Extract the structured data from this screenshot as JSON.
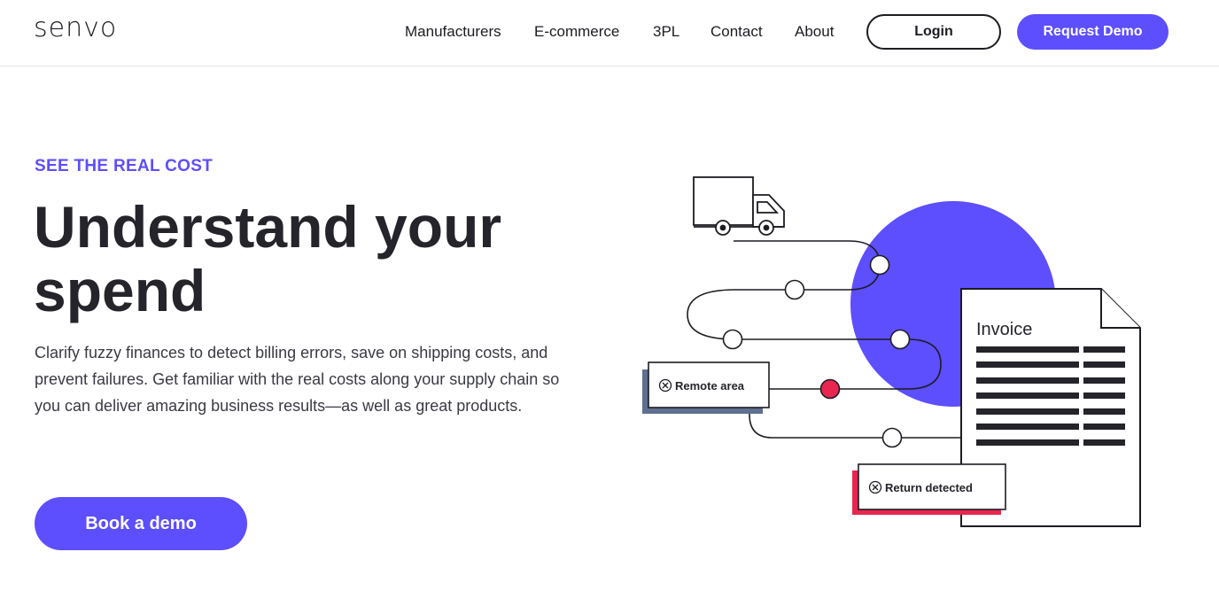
{
  "header": {
    "logo": "senvo",
    "nav": [
      "Manufacturers",
      "E-commerce",
      "3PL",
      "Contact",
      "About"
    ],
    "login_label": "Login",
    "request_demo_label": "Request Demo"
  },
  "hero": {
    "eyebrow": "SEE THE REAL COST",
    "headline_line1": "Understand your",
    "headline_line2": "spend",
    "body": "Clarify fuzzy finances to detect billing errors, save on shipping costs, and prevent failures. Get familiar with the real costs along your supply chain so you can deliver amazing business results—as well as great products.",
    "cta_label": "Book a demo"
  },
  "illustration": {
    "invoice_title": "Invoice",
    "remote_area_label": "Remote area",
    "return_detected_label": "Return detected",
    "icons": [
      "truck-icon",
      "invoice-document-icon",
      "close-circle-icon"
    ]
  },
  "colors": {
    "accent": "#5d4efe",
    "alert": "#e8264f",
    "shadow_slate": "#5f6f8f",
    "text_dark": "#24242a"
  }
}
